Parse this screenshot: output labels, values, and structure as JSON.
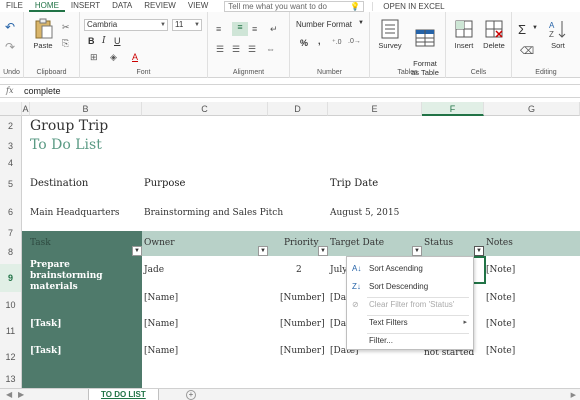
{
  "ribbon_tabs": [
    "FILE",
    "HOME",
    "INSERT",
    "DATA",
    "REVIEW",
    "VIEW"
  ],
  "tell_me": "Tell me what you want to do",
  "open_in_excel": "OPEN IN EXCEL",
  "ribbon": {
    "undo_label": "Undo",
    "clipboard": {
      "paste": "Paste",
      "label": "Clipboard"
    },
    "font": {
      "name": "Cambria",
      "size": "11",
      "bold": "B",
      "italic": "I",
      "underline": "U",
      "label": "Font"
    },
    "alignment": {
      "label": "Alignment"
    },
    "number": {
      "format": "Number Format",
      "percent": "%",
      "comma": ",",
      "label": "Number"
    },
    "tables": {
      "survey": "Survey",
      "format_as_table": "Format\nas Table",
      "label": "Tables"
    },
    "cells": {
      "insert": "Insert",
      "delete": "Delete",
      "label": "Cells"
    },
    "editing": {
      "sort": "Sort",
      "label": "Editing"
    }
  },
  "formula_bar": {
    "fx": "fx",
    "value": "complete"
  },
  "columns": [
    "A",
    "B",
    "C",
    "D",
    "E",
    "F",
    "G"
  ],
  "rows": [
    "2",
    "3",
    "4",
    "5",
    "6",
    "7",
    "8",
    "9",
    "10",
    "11",
    "12",
    "13"
  ],
  "sheet": {
    "title": "Group Trip",
    "subtitle": "To Do List",
    "destination_label": "Destination",
    "purpose_label": "Purpose",
    "trip_date_label": "Trip Date",
    "destination": "Main Headquarters",
    "purpose": "Brainstorming and Sales Pitch",
    "trip_date": "August 5, 2015",
    "headers": [
      "Task",
      "Owner",
      "Priority",
      "Target Date",
      "Status",
      "Notes"
    ],
    "tasks": [
      {
        "task": "Prepare brainstorming materials",
        "owner": "Jade",
        "priority": "2",
        "date": "July",
        "notes": "[Note]"
      },
      {
        "task": "",
        "owner": "[Name]",
        "priority": "[Number]",
        "date": "[Dat",
        "notes": "[Note]"
      },
      {
        "task": "[Task]",
        "owner": "[Name]",
        "priority": "[Number]",
        "date": "[Dat",
        "notes": "[Note]"
      },
      {
        "task": "[Task]",
        "owner": "[Name]",
        "priority": "[Number]",
        "date": "[Date]",
        "status": "not started",
        "notes": "[Note]"
      }
    ]
  },
  "filter_menu": {
    "sort_asc": "Sort Ascending",
    "sort_desc": "Sort Descending",
    "clear_filter": "Clear Filter from 'Status'",
    "text_filters": "Text Filters",
    "filter": "Filter..."
  },
  "sheet_tab": "TO DO LIST"
}
